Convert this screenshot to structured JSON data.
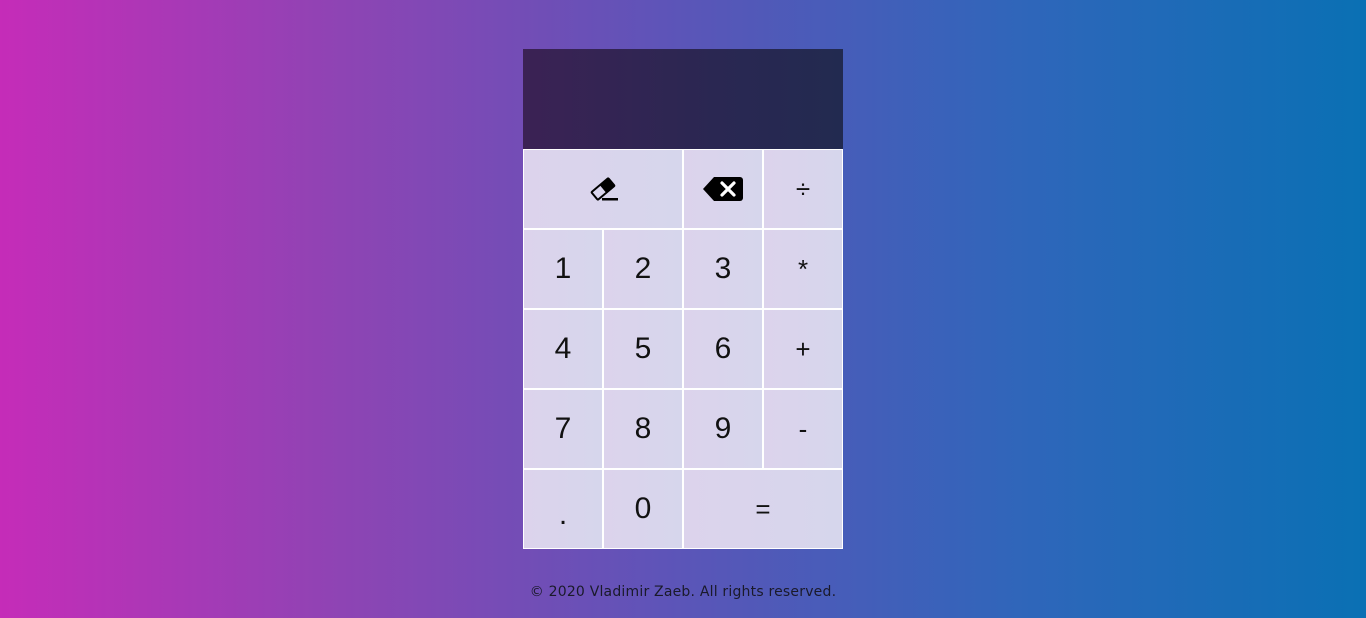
{
  "display": {
    "value": ""
  },
  "keys": {
    "clear": {
      "icon": "eraser-icon"
    },
    "backspace": {
      "icon": "backspace-icon"
    },
    "divide": "÷",
    "one": "1",
    "two": "2",
    "three": "3",
    "multiply": "*",
    "four": "4",
    "five": "5",
    "six": "6",
    "plus": "+",
    "seven": "7",
    "eight": "8",
    "nine": "9",
    "minus": "-",
    "dot": ".",
    "zero": "0",
    "equals": "="
  },
  "footer": {
    "text": "© 2020 Vladimir Zaeb. All rights reserved."
  },
  "colors": {
    "display_background": "#2a2752",
    "key_background": "#d9d4ec",
    "gradient_left": "#c52cb8",
    "gradient_right": "#0a70b4"
  }
}
